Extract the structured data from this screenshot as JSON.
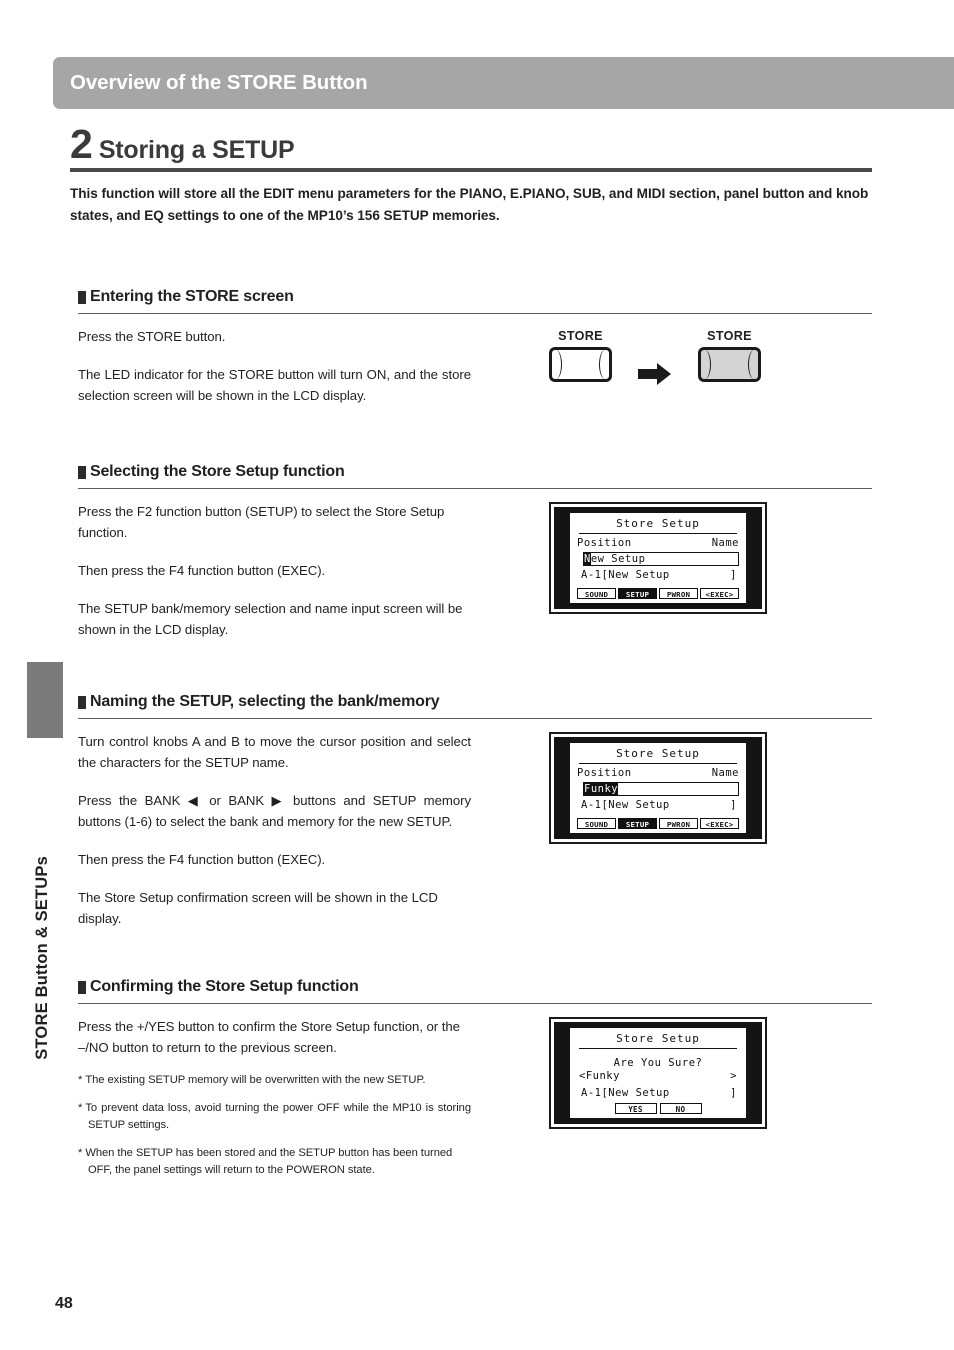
{
  "header": {
    "title": "Overview of the STORE Button"
  },
  "sidebar": {
    "label": "STORE Button & SETUPs"
  },
  "chapter": {
    "number": "2",
    "name": "Storing a SETUP",
    "description": "This function will store all the EDIT menu parameters for the PIANO, E.PIANO, SUB, and MIDI section, panel button and knob states, and EQ settings to one of the MP10’s 156 SETUP memories."
  },
  "sections": [
    {
      "heading": "Entering the STORE screen",
      "paragraphs": [
        "Press the STORE button.",
        "The LED indicator for the STORE button will turn ON, and the store selection screen will be shown in the LCD display."
      ],
      "figure": {
        "type": "store-buttons",
        "button_off_label": "STORE",
        "button_on_label": "STORE",
        "arrow_icon": "arrow-right-icon"
      }
    },
    {
      "heading": "Selecting the Store Setup function",
      "paragraphs": [
        "Press the F2 function button (SETUP) to select the Store Setup function.",
        "Then press the F4 function button (EXEC).",
        "The SETUP bank/memory selection and name input screen will be shown in the LCD display."
      ],
      "figure": {
        "type": "lcd-name-input",
        "title": "Store Setup",
        "label_left": "Position",
        "label_right": "Name",
        "name_cursor_char": "N",
        "name_rest": "ew Setup",
        "slot_left": "A-1[New Setup",
        "slot_right": "]",
        "fkeys": [
          {
            "label": "SOUND",
            "active": false
          },
          {
            "label": "SETUP",
            "active": true
          },
          {
            "label": "PWRON",
            "active": false
          },
          {
            "label": "<EXEC>",
            "active": false
          }
        ]
      }
    },
    {
      "heading": "Naming the SETUP, selecting the bank/memory",
      "paragraphs": [
        "Turn control knobs A and B to move the cursor position and select the characters for the SETUP name.",
        "Press the BANK ◀ or BANK ▶ buttons and SETUP memory buttons (1-6) to select the bank and memory for the new SETUP.",
        "Then press the F4 function button (EXEC).",
        "The Store Setup confirmation screen will be shown in the LCD display."
      ],
      "figure": {
        "type": "lcd-name-input",
        "title": "Store Setup",
        "label_left": "Position",
        "label_right": "Name",
        "name_cursor_char": "Funky",
        "name_rest": "",
        "slot_left": "A-1[New Setup",
        "slot_right": "]",
        "fkeys": [
          {
            "label": "SOUND",
            "active": false
          },
          {
            "label": "SETUP",
            "active": true
          },
          {
            "label": "PWRON",
            "active": false
          },
          {
            "label": "<EXEC>",
            "active": false
          }
        ]
      }
    },
    {
      "heading": "Confirming the Store Setup function",
      "paragraphs": [
        "Press the +/YES button to confirm the Store Setup function, or the –/NO button to return to the previous screen."
      ],
      "notes": [
        "The existing SETUP memory will be overwritten with the new SETUP.",
        "To prevent data loss, avoid turning the power OFF while the MP10 is storing SETUP settings.",
        "When the SETUP has been stored and the SETUP button has been turned OFF, the panel settings will return to the POWERON state."
      ],
      "figure": {
        "type": "lcd-confirm",
        "title": "Store Setup",
        "question": "Are You Sure?",
        "value_left": "<Funky",
        "value_right": ">",
        "slot_left": "A-1[New Setup",
        "slot_right": "]",
        "yes_label": "YES",
        "no_label": "NO"
      }
    }
  ],
  "footer": {
    "page_number": "48"
  }
}
